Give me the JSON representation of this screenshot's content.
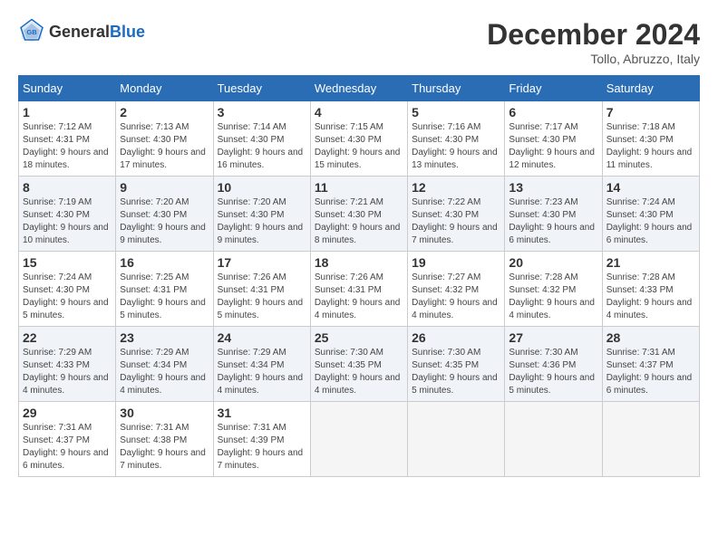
{
  "header": {
    "logo_general": "General",
    "logo_blue": "Blue",
    "month_title": "December 2024",
    "location": "Tollo, Abruzzo, Italy"
  },
  "weekdays": [
    "Sunday",
    "Monday",
    "Tuesday",
    "Wednesday",
    "Thursday",
    "Friday",
    "Saturday"
  ],
  "weeks": [
    [
      {
        "day": "1",
        "info": "Sunrise: 7:12 AM\nSunset: 4:31 PM\nDaylight: 9 hours and 18 minutes."
      },
      {
        "day": "2",
        "info": "Sunrise: 7:13 AM\nSunset: 4:30 PM\nDaylight: 9 hours and 17 minutes."
      },
      {
        "day": "3",
        "info": "Sunrise: 7:14 AM\nSunset: 4:30 PM\nDaylight: 9 hours and 16 minutes."
      },
      {
        "day": "4",
        "info": "Sunrise: 7:15 AM\nSunset: 4:30 PM\nDaylight: 9 hours and 15 minutes."
      },
      {
        "day": "5",
        "info": "Sunrise: 7:16 AM\nSunset: 4:30 PM\nDaylight: 9 hours and 13 minutes."
      },
      {
        "day": "6",
        "info": "Sunrise: 7:17 AM\nSunset: 4:30 PM\nDaylight: 9 hours and 12 minutes."
      },
      {
        "day": "7",
        "info": "Sunrise: 7:18 AM\nSunset: 4:30 PM\nDaylight: 9 hours and 11 minutes."
      }
    ],
    [
      {
        "day": "8",
        "info": "Sunrise: 7:19 AM\nSunset: 4:30 PM\nDaylight: 9 hours and 10 minutes."
      },
      {
        "day": "9",
        "info": "Sunrise: 7:20 AM\nSunset: 4:30 PM\nDaylight: 9 hours and 9 minutes."
      },
      {
        "day": "10",
        "info": "Sunrise: 7:20 AM\nSunset: 4:30 PM\nDaylight: 9 hours and 9 minutes."
      },
      {
        "day": "11",
        "info": "Sunrise: 7:21 AM\nSunset: 4:30 PM\nDaylight: 9 hours and 8 minutes."
      },
      {
        "day": "12",
        "info": "Sunrise: 7:22 AM\nSunset: 4:30 PM\nDaylight: 9 hours and 7 minutes."
      },
      {
        "day": "13",
        "info": "Sunrise: 7:23 AM\nSunset: 4:30 PM\nDaylight: 9 hours and 6 minutes."
      },
      {
        "day": "14",
        "info": "Sunrise: 7:24 AM\nSunset: 4:30 PM\nDaylight: 9 hours and 6 minutes."
      }
    ],
    [
      {
        "day": "15",
        "info": "Sunrise: 7:24 AM\nSunset: 4:30 PM\nDaylight: 9 hours and 5 minutes."
      },
      {
        "day": "16",
        "info": "Sunrise: 7:25 AM\nSunset: 4:31 PM\nDaylight: 9 hours and 5 minutes."
      },
      {
        "day": "17",
        "info": "Sunrise: 7:26 AM\nSunset: 4:31 PM\nDaylight: 9 hours and 5 minutes."
      },
      {
        "day": "18",
        "info": "Sunrise: 7:26 AM\nSunset: 4:31 PM\nDaylight: 9 hours and 4 minutes."
      },
      {
        "day": "19",
        "info": "Sunrise: 7:27 AM\nSunset: 4:32 PM\nDaylight: 9 hours and 4 minutes."
      },
      {
        "day": "20",
        "info": "Sunrise: 7:28 AM\nSunset: 4:32 PM\nDaylight: 9 hours and 4 minutes."
      },
      {
        "day": "21",
        "info": "Sunrise: 7:28 AM\nSunset: 4:33 PM\nDaylight: 9 hours and 4 minutes."
      }
    ],
    [
      {
        "day": "22",
        "info": "Sunrise: 7:29 AM\nSunset: 4:33 PM\nDaylight: 9 hours and 4 minutes."
      },
      {
        "day": "23",
        "info": "Sunrise: 7:29 AM\nSunset: 4:34 PM\nDaylight: 9 hours and 4 minutes."
      },
      {
        "day": "24",
        "info": "Sunrise: 7:29 AM\nSunset: 4:34 PM\nDaylight: 9 hours and 4 minutes."
      },
      {
        "day": "25",
        "info": "Sunrise: 7:30 AM\nSunset: 4:35 PM\nDaylight: 9 hours and 4 minutes."
      },
      {
        "day": "26",
        "info": "Sunrise: 7:30 AM\nSunset: 4:35 PM\nDaylight: 9 hours and 5 minutes."
      },
      {
        "day": "27",
        "info": "Sunrise: 7:30 AM\nSunset: 4:36 PM\nDaylight: 9 hours and 5 minutes."
      },
      {
        "day": "28",
        "info": "Sunrise: 7:31 AM\nSunset: 4:37 PM\nDaylight: 9 hours and 6 minutes."
      }
    ],
    [
      {
        "day": "29",
        "info": "Sunrise: 7:31 AM\nSunset: 4:37 PM\nDaylight: 9 hours and 6 minutes."
      },
      {
        "day": "30",
        "info": "Sunrise: 7:31 AM\nSunset: 4:38 PM\nDaylight: 9 hours and 7 minutes."
      },
      {
        "day": "31",
        "info": "Sunrise: 7:31 AM\nSunset: 4:39 PM\nDaylight: 9 hours and 7 minutes."
      },
      {
        "day": "",
        "info": ""
      },
      {
        "day": "",
        "info": ""
      },
      {
        "day": "",
        "info": ""
      },
      {
        "day": "",
        "info": ""
      }
    ]
  ]
}
